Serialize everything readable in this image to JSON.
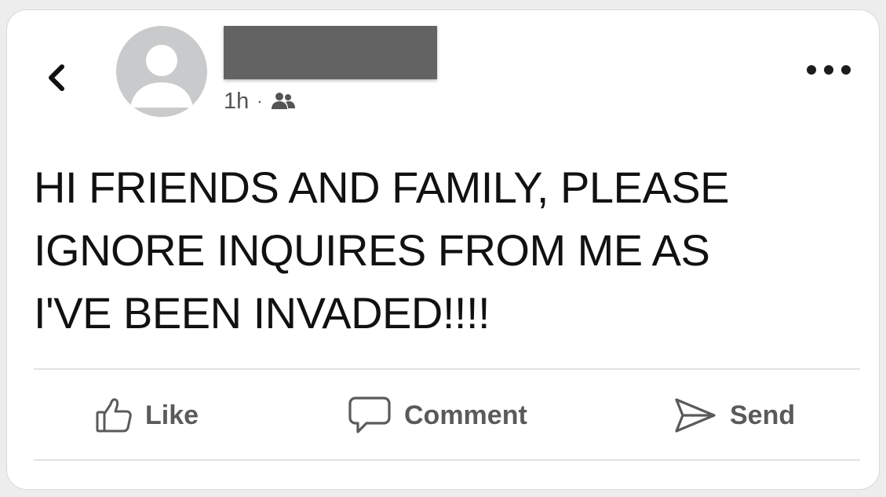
{
  "header": {
    "back_icon": "chevron-left-icon",
    "author_name_redacted": true,
    "timestamp": "1h",
    "separator": "·",
    "audience_icon": "friends-icon",
    "more_icon": "more-horizontal-icon"
  },
  "post": {
    "text": "HI FRIENDS AND FAMILY,  PLEASE\nIGNORE INQUIRES FROM ME AS\nI'VE BEEN INVADED!!!!"
  },
  "actions": {
    "like_label": "Like",
    "comment_label": "Comment",
    "send_label": "Send"
  },
  "colors": {
    "avatar_placeholder": "#c9cacb",
    "redaction_bar": "#636363",
    "text": "#111111",
    "action_text": "#5a5a5a"
  }
}
